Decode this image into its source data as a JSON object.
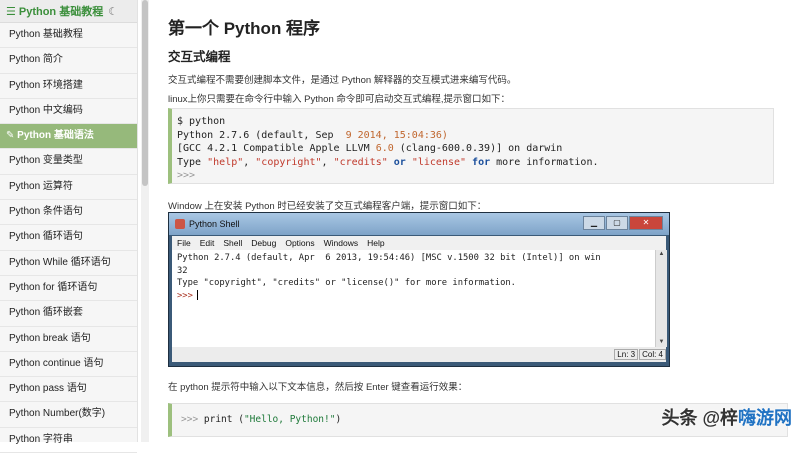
{
  "sidebar": {
    "title": "Python 基础教程",
    "items": [
      {
        "label": "Python 基础教程",
        "active": false
      },
      {
        "label": "Python 简介",
        "active": false
      },
      {
        "label": "Python 环境搭建",
        "active": false
      },
      {
        "label": "Python 中文编码",
        "active": false
      },
      {
        "label": "Python 基础语法",
        "active": true
      },
      {
        "label": "Python 变量类型",
        "active": false
      },
      {
        "label": "Python 运算符",
        "active": false
      },
      {
        "label": "Python 条件语句",
        "active": false
      },
      {
        "label": "Python 循环语句",
        "active": false
      },
      {
        "label": "Python While 循环语句",
        "active": false
      },
      {
        "label": "Python for 循环语句",
        "active": false
      },
      {
        "label": "Python 循环嵌套",
        "active": false
      },
      {
        "label": "Python break 语句",
        "active": false
      },
      {
        "label": "Python continue 语句",
        "active": false
      },
      {
        "label": "Python pass 语句",
        "active": false
      },
      {
        "label": "Python Number(数字)",
        "active": false
      },
      {
        "label": "Python 字符串",
        "active": false
      }
    ]
  },
  "content": {
    "title": "第一个 Python 程序",
    "subtitle": "交互式编程",
    "para1": "交互式编程不需要创建脚本文件，是通过 Python 解释器的交互模式进来编写代码。",
    "para2": "linux上你只需要在命令行中输入 Python 命令即可启动交互式编程,提示窗口如下：",
    "code1": {
      "line1": "$ python",
      "line2_a": "Python 2.7.6 (default, Sep ",
      "line2_num": " 9 2014, 15:04:36)",
      "line3_a": "[GCC 4.2.1 Compatible Apple LLVM ",
      "line3_num": "6.0",
      "line3_b": " (clang-600.0.39)] on darwin",
      "line4_a": "Type ",
      "line4_s1": "\"help\"",
      "line4_c1": ", ",
      "line4_s2": "\"copyright\"",
      "line4_c2": ", ",
      "line4_s3": "\"credits\"",
      "line4_or": " or ",
      "line4_s4": "\"license\"",
      "line4_for": " for",
      "line4_end": " more information.",
      "line5": ">>>"
    },
    "para3": "Window 上在安装 Python 时已经安装了交互式编程客户端，提示窗口如下：",
    "shell": {
      "title": "Python Shell",
      "menu": [
        "File",
        "Edit",
        "Shell",
        "Debug",
        "Options",
        "Windows",
        "Help"
      ],
      "line1": "Python 2.7.4 (default, Apr  6 2013, 19:54:46) [MSC v.1500 32 bit (Intel)] on win",
      "line2": "32",
      "line3": "Type \"copyright\", \"credits\" or \"license()\" for more information.",
      "prompt": ">>>",
      "status_ln": "Ln: 3",
      "status_col": "Col: 4"
    },
    "para4": "在 python 提示符中输入以下文本信息，然后按 Enter 键查看运行效果：",
    "code2": {
      "prompt": ">>>",
      "text_a": " print (",
      "text_str": "\"Hello, Python!\"",
      "text_b": ")"
    }
  },
  "watermark": {
    "prefix": "头条 @梓",
    "site": "嗨游网"
  },
  "colors": {
    "accent_green": "#96b97b",
    "header_green": "#3b8f3b"
  }
}
